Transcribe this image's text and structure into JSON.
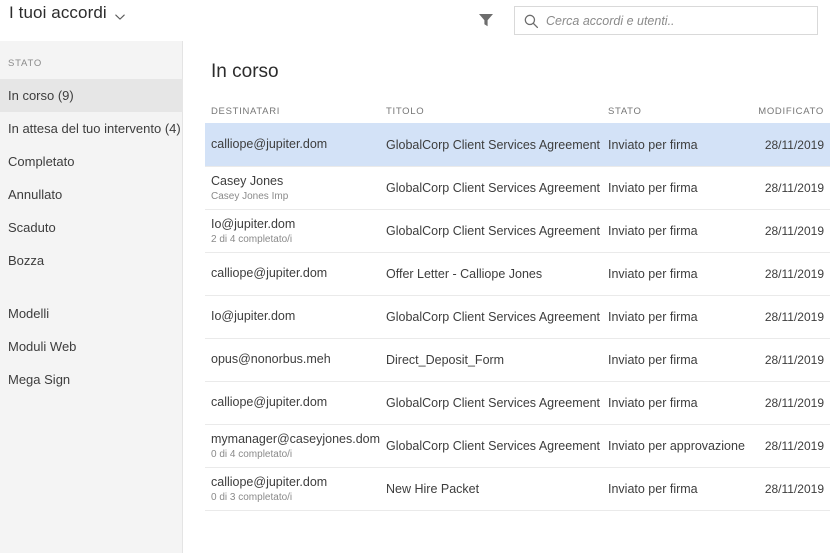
{
  "topbar": {
    "app_title": "I tuoi accordi",
    "title_chevron_icon": "chevron-down-icon",
    "filter_icon": "filter-funnel-icon",
    "search": {
      "icon": "search-icon",
      "value": "",
      "placeholder": "Cerca accordi e utenti.."
    }
  },
  "sidebar": {
    "heading": "STATO",
    "items": [
      {
        "label": "In corso (9)",
        "selected": true
      },
      {
        "label": "In attesa del tuo intervento (4)",
        "selected": false
      },
      {
        "label": "Completato",
        "selected": false
      },
      {
        "label": "Annullato",
        "selected": false
      },
      {
        "label": "Scaduto",
        "selected": false
      },
      {
        "label": "Bozza",
        "selected": false
      },
      {
        "label": "Modelli",
        "selected": false
      },
      {
        "label": "Moduli Web",
        "selected": false
      },
      {
        "label": "Mega Sign",
        "selected": false
      }
    ]
  },
  "main": {
    "section_title": "In corso",
    "columns": {
      "recipients": "DESTINATARI",
      "title": "TITOLO",
      "status": "STATO",
      "modified": "MODIFICATO"
    },
    "rows": [
      {
        "recipient": "calliope@jupiter.dom",
        "recipient_sub": "",
        "title": "GlobalCorp Client Services Agreement",
        "status": "Inviato per firma",
        "modified": "28/11/2019",
        "selected": true
      },
      {
        "recipient": "Casey Jones",
        "recipient_sub": "Casey Jones Imp",
        "title": "GlobalCorp Client Services Agreement",
        "status": "Inviato per firma",
        "modified": "28/11/2019",
        "selected": false
      },
      {
        "recipient": "Io@jupiter.dom",
        "recipient_sub": "2 di 4 completato/i",
        "title": "GlobalCorp Client Services Agreement",
        "status": "Inviato per firma",
        "modified": "28/11/2019",
        "selected": false
      },
      {
        "recipient": "calliope@jupiter.dom",
        "recipient_sub": "",
        "title": "Offer Letter - Calliope Jones",
        "status": "Inviato per firma",
        "modified": "28/11/2019",
        "selected": false
      },
      {
        "recipient": "Io@jupiter.dom",
        "recipient_sub": "",
        "title": "GlobalCorp Client Services Agreement",
        "status": "Inviato per firma",
        "modified": "28/11/2019",
        "selected": false
      },
      {
        "recipient": "opus@nonorbus.meh",
        "recipient_sub": "",
        "title": "Direct_Deposit_Form",
        "status": "Inviato per firma",
        "modified": "28/11/2019",
        "selected": false
      },
      {
        "recipient": "calliope@jupiter.dom",
        "recipient_sub": "",
        "title": "GlobalCorp Client Services Agreement",
        "status": "Inviato per firma",
        "modified": "28/11/2019",
        "selected": false
      },
      {
        "recipient": "mymanager@caseyjones.dom",
        "recipient_sub": "0 di 4 completato/i",
        "title": "GlobalCorp Client Services Agreement",
        "status": "Inviato per approvazione",
        "modified": "28/11/2019",
        "selected": false
      },
      {
        "recipient": "calliope@jupiter.dom",
        "recipient_sub": "0 di 3 completato/i",
        "title": "New Hire Packet",
        "status": "Inviato per firma",
        "modified": "28/11/2019",
        "selected": false
      }
    ]
  },
  "colors": {
    "selected_row": "#d3e2f7",
    "sidebar_bg": "#f4f4f4",
    "sidebar_selected": "#e6e6e6",
    "divider": "#eaeaea",
    "text": "#3d3d3d",
    "muted_text": "#8a8a8a"
  }
}
